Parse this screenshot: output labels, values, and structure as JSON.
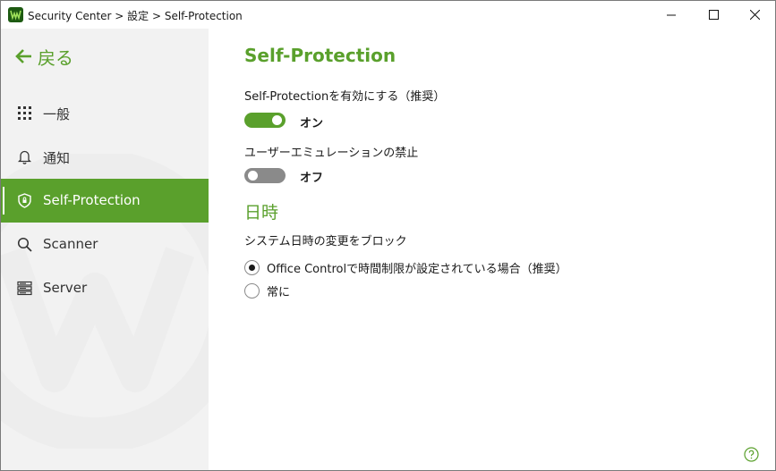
{
  "window": {
    "title": "Security Center > 設定 > Self-Protection",
    "controls": {
      "minimize_icon": "minimize-icon",
      "maximize_icon": "maximize-icon",
      "close_icon": "close-icon"
    }
  },
  "sidebar": {
    "back_label": "戻る",
    "items": [
      {
        "label": "一般",
        "icon": "grid-icon",
        "active": false
      },
      {
        "label": "通知",
        "icon": "bell-icon",
        "active": false
      },
      {
        "label": "Self-Protection",
        "icon": "shield-icon",
        "active": true
      },
      {
        "label": "Scanner",
        "icon": "search-icon",
        "active": false
      },
      {
        "label": "Server",
        "icon": "server-icon",
        "active": false
      }
    ]
  },
  "main": {
    "title": "Self-Protection",
    "settings": [
      {
        "label": "Self-Protectionを有効にする（推奨）",
        "state_label": "オン",
        "enabled": true
      },
      {
        "label": "ユーザーエミュレーションの禁止",
        "state_label": "オフ",
        "enabled": false
      }
    ],
    "datetime_section": {
      "heading": "日時",
      "label": "システム日時の変更をブロック",
      "options": [
        {
          "label": "Office Controlで時間制限が設定されている場合（推奨）",
          "checked": true
        },
        {
          "label": "常に",
          "checked": false
        }
      ]
    },
    "help_icon": "help-icon"
  },
  "colors": {
    "accent": "#5aa02c",
    "sidebar_bg": "#f2f2f2",
    "toggle_off": "#8a8a8a"
  }
}
